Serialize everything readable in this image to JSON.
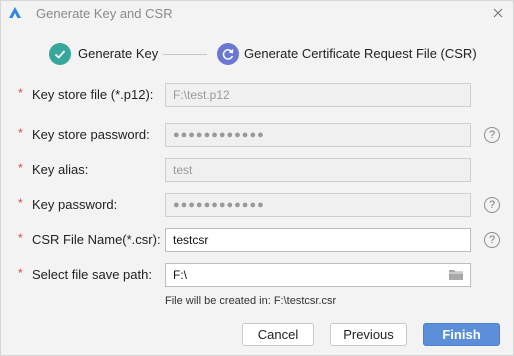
{
  "window": {
    "title": "Generate Key and CSR"
  },
  "steps": [
    {
      "label": "Generate Key",
      "state": "complete",
      "icon": "check-icon",
      "color": "#36a79a"
    },
    {
      "label": "Generate Certificate Request File (CSR)",
      "state": "in-progress",
      "icon": "refresh-icon",
      "color": "#6a78d2"
    }
  ],
  "form": {
    "required_mark": "*",
    "fields": [
      {
        "label": "Key store file (*.p12):",
        "value": "F:\\test.p12",
        "editable": false
      },
      {
        "label": "Key store password:",
        "value": "●●●●●●●●●●●●",
        "editable": false,
        "help": "?"
      },
      {
        "label": "Key alias:",
        "value": "test",
        "editable": false
      },
      {
        "label": "Key password:",
        "value": "●●●●●●●●●●●●",
        "editable": false,
        "help": "?"
      },
      {
        "label": "CSR File Name(*.csr):",
        "value": "testcsr",
        "editable": true,
        "help": "?"
      },
      {
        "label": "Select file save path:",
        "value": "F:\\",
        "editable": true,
        "icon": "folder-icon"
      }
    ],
    "info": "File will be created in: F:\\testcsr.csr"
  },
  "buttons": {
    "cancel": "Cancel",
    "previous": "Previous",
    "finish": "Finish"
  },
  "colors": {
    "accent": "#5b8fd9",
    "required": "#d64a4a"
  }
}
